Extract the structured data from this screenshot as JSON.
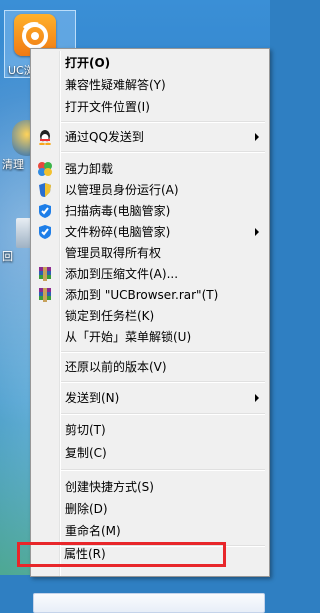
{
  "desktop": {
    "icons": [
      {
        "label": "UC浏",
        "name": "uc-browser"
      },
      {
        "label": "清理",
        "name": "cleanup"
      },
      {
        "label": "回",
        "name": "recycle-bin"
      }
    ]
  },
  "menu": {
    "items": [
      {
        "label": "打开(O)",
        "bold": true
      },
      {
        "label": "兼容性疑难解答(Y)"
      },
      {
        "label": "打开文件位置(I)"
      },
      {
        "label": "通过QQ发送到",
        "icon": "qq-icon",
        "submenu": true
      },
      {
        "label": "强力卸载",
        "icon": "uninstall-icon"
      },
      {
        "label": "以管理员身份运行(A)",
        "icon": "shield-icon"
      },
      {
        "label": "扫描病毒(电脑管家)",
        "icon": "guard-icon"
      },
      {
        "label": "文件粉碎(电脑管家)",
        "icon": "guard-icon",
        "submenu": true
      },
      {
        "label": "管理员取得所有权"
      },
      {
        "label": "添加到压缩文件(A)...",
        "icon": "rar-icon"
      },
      {
        "label": "添加到 \"UCBrowser.rar\"(T)",
        "icon": "rar-icon"
      },
      {
        "label": "锁定到任务栏(K)"
      },
      {
        "label": "从「开始」菜单解锁(U)"
      },
      {
        "label": "还原以前的版本(V)"
      },
      {
        "label": "发送到(N)",
        "submenu": true
      },
      {
        "label": "剪切(T)"
      },
      {
        "label": "复制(C)"
      },
      {
        "label": "创建快捷方式(S)"
      },
      {
        "label": "删除(D)"
      },
      {
        "label": "重命名(M)"
      },
      {
        "label": "属性(R)"
      }
    ]
  },
  "colors": {
    "highlight": "#e8262a",
    "menu_bg": "#f0f0f0"
  }
}
